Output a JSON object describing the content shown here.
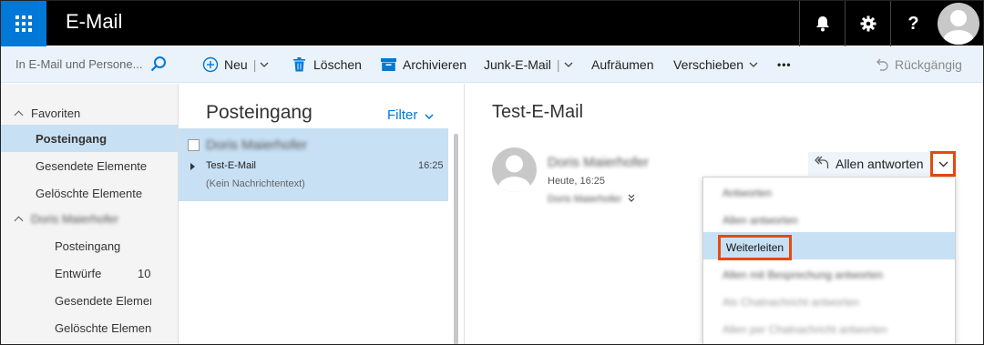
{
  "app": {
    "title": "E-Mail"
  },
  "topbar": {
    "icons": [
      "app-launcher-icon",
      "bell-icon",
      "gear-icon",
      "help-icon",
      "avatar"
    ],
    "help_label": "?"
  },
  "search": {
    "placeholder": "In E-Mail und Persone..."
  },
  "toolbar": {
    "new_label": "Neu",
    "delete_label": "Löschen",
    "archive_label": "Archivieren",
    "junk_label": "Junk-E-Mail",
    "sweep_label": "Aufräumen",
    "move_label": "Verschieben",
    "more_label": "•••",
    "undo_label": "Rückgängig"
  },
  "sidebar": {
    "favorites_header": "Favoriten",
    "favorites": [
      {
        "label": "Posteingang",
        "selected": true
      },
      {
        "label": "Gesendete Elemente"
      },
      {
        "label": "Gelöschte Elemente"
      }
    ],
    "account_header": "Doris Maierhofer",
    "folders": [
      {
        "label": "Posteingang",
        "count": ""
      },
      {
        "label": "Entwürfe",
        "count": "10"
      },
      {
        "label": "Gesendete Elemer",
        "count": ""
      },
      {
        "label": "Gelöschte Elemen",
        "count": ""
      }
    ]
  },
  "message_list": {
    "title": "Posteingang",
    "filter_label": "Filter",
    "messages": [
      {
        "sender": "Doris Maierhofer",
        "subject": "Test-E-Mail",
        "time": "16:25",
        "preview": "(Kein Nachrichtentext)"
      }
    ]
  },
  "reading_pane": {
    "subject": "Test-E-Mail",
    "sender": "Doris Maierhofer",
    "date": "Heute, 16:25",
    "to": "Doris Maierhofer",
    "reply_all_label": "Allen antworten"
  },
  "reply_menu": {
    "items": [
      {
        "label": "Antworten",
        "blurred": true
      },
      {
        "label": "Allen antworten",
        "blurred": true
      },
      {
        "label": "Weiterleiten",
        "highlighted": true
      },
      {
        "label": "Allen mit Besprechung antworten",
        "blurred": true
      },
      {
        "label": "Als Chatnachricht antworten",
        "blurred": true
      },
      {
        "label": "Allen per Chatnachricht antworten",
        "blurred": true
      }
    ]
  },
  "colors": {
    "accent": "#0078d7",
    "highlight_box": "#e8490f",
    "selection": "#c7e0f4",
    "topbar": "#000000"
  }
}
